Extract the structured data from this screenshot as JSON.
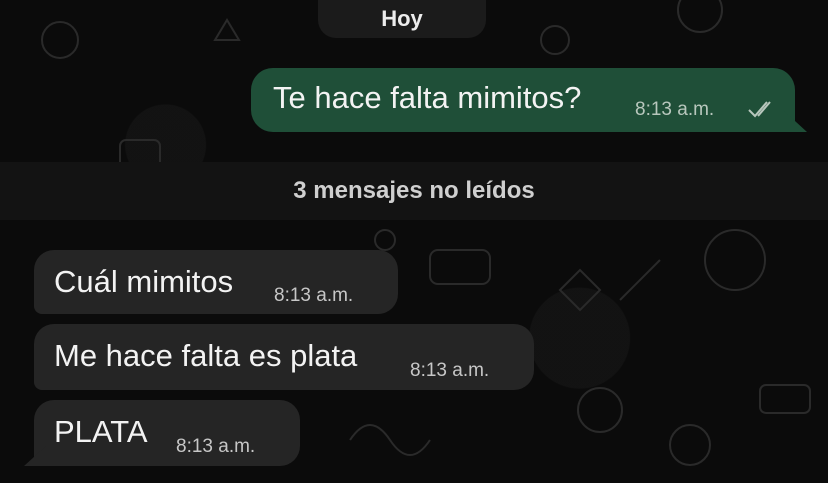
{
  "date_chip": "Hoy",
  "outgoing": [
    {
      "text": "Te hace falta mimitos?",
      "time": "8:13 a.m.",
      "status": "read-double-check-icon"
    }
  ],
  "unread_banner": "3 mensajes no leídos",
  "incoming": [
    {
      "text": "Cuál mimitos",
      "time": "8:13 a.m."
    },
    {
      "text": "Me hace falta es plata",
      "time": "8:13 a.m."
    },
    {
      "text": "PLATA",
      "time": "8:13 a.m."
    }
  ],
  "colors": {
    "background": "#0b0b0b",
    "outgoing_bubble": "#1f4f38",
    "incoming_bubble": "#252525",
    "unread_bar": "#131313"
  }
}
